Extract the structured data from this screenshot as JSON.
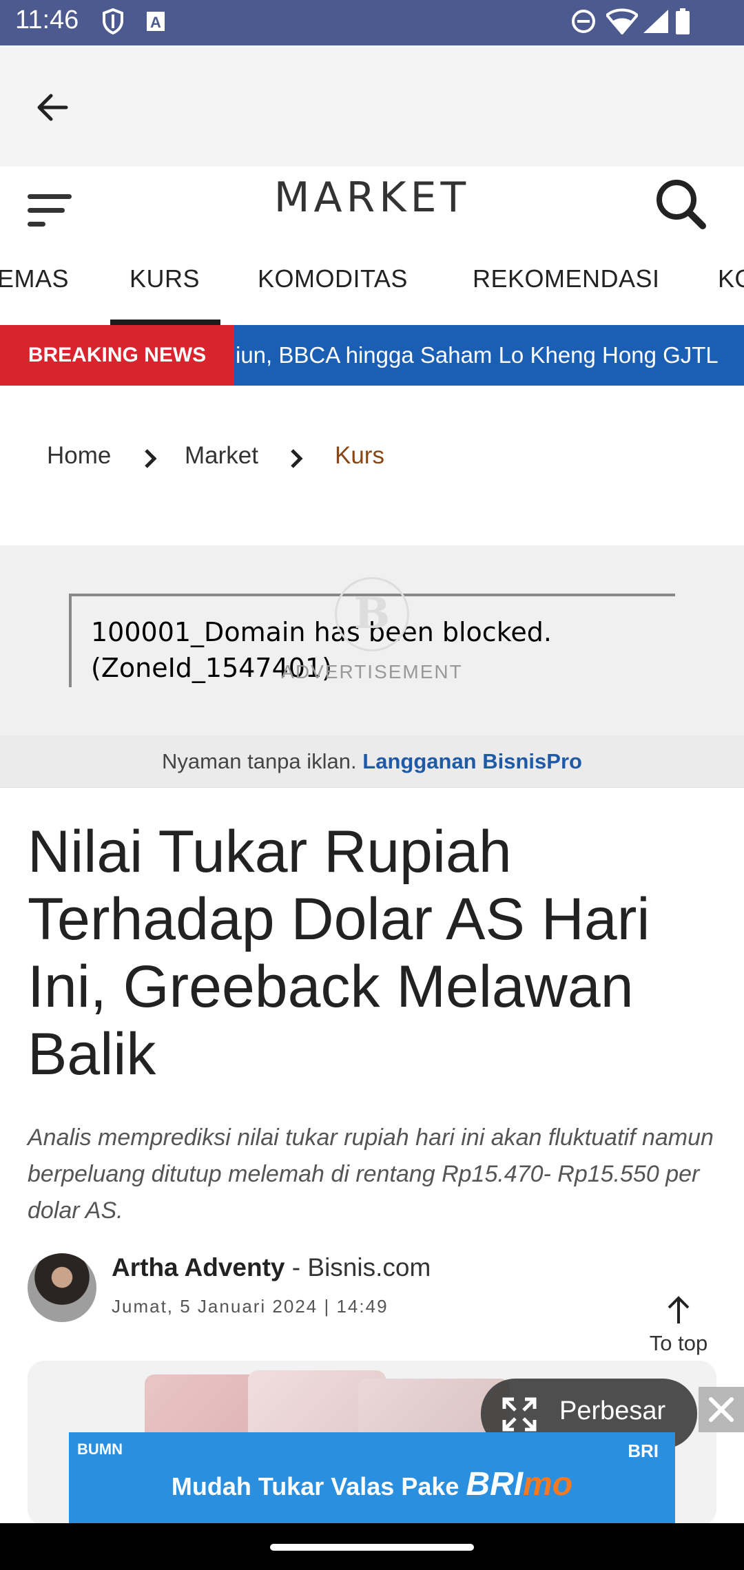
{
  "status_bar": {
    "time": "11:46",
    "icons": [
      "shield-icon",
      "font-a-icon",
      "do-not-disturb-icon",
      "wifi-icon",
      "signal-icon",
      "battery-icon"
    ]
  },
  "app_bar": {
    "back_icon": "arrow-left-icon"
  },
  "header": {
    "title": "MARKET",
    "menu_icon": "hamburger-icon",
    "search_icon": "search-icon"
  },
  "tabs": {
    "items": [
      {
        "label": "EMAS"
      },
      {
        "label": "KURS"
      },
      {
        "label": "KOMODITAS"
      },
      {
        "label": "REKOMENDASI"
      },
      {
        "label": "KO"
      }
    ],
    "active": "KURS"
  },
  "breaking_news": {
    "label": "BREAKING NEWS",
    "headline": "iun, BBCA hingga Saham Lo Kheng Hong GJTL"
  },
  "breadcrumb": {
    "home": "Home",
    "market": "Market",
    "current": "Kurs"
  },
  "ad": {
    "message_line1": "100001_Domain has been blocked.",
    "message_line2": "(ZoneId_1547401)",
    "label": "ADVERTISEMENT",
    "logo_letter": "B"
  },
  "subscribe": {
    "text": "Nyaman tanpa iklan.",
    "cta": "Langganan BisnisPro"
  },
  "article": {
    "title": "Nilai Tukar Rupiah Terhadap Dolar AS Hari Ini, Greeback Melawan Balik",
    "lead": "Analis memprediksi nilai tukar rupiah hari ini akan fluktuatif namun berpeluang ditutup melemah di rentang Rp15.470- Rp15.550 per dolar AS.",
    "author": "Artha Adventy",
    "source": "- Bisnis.com",
    "date": "Jumat, 5 Januari 2024 | 14:49"
  },
  "to_top": {
    "label": "To top"
  },
  "image_overlay": {
    "expand_label": "Perbesar"
  },
  "bottom_banner": {
    "bumn": "BUMN",
    "bri": "BRI",
    "text": "Mudah Tukar Valas Pake",
    "brand_bri": "BRI",
    "brand_mo": "mo"
  },
  "colors": {
    "status_bar": "#4c5a8f",
    "breaking_red": "#d9232d",
    "breaking_blue": "#1a5fb4",
    "breadcrumb_active": "#8b4513",
    "cta_blue": "#1f5aa6",
    "banner_blue": "#2b8fe0"
  }
}
